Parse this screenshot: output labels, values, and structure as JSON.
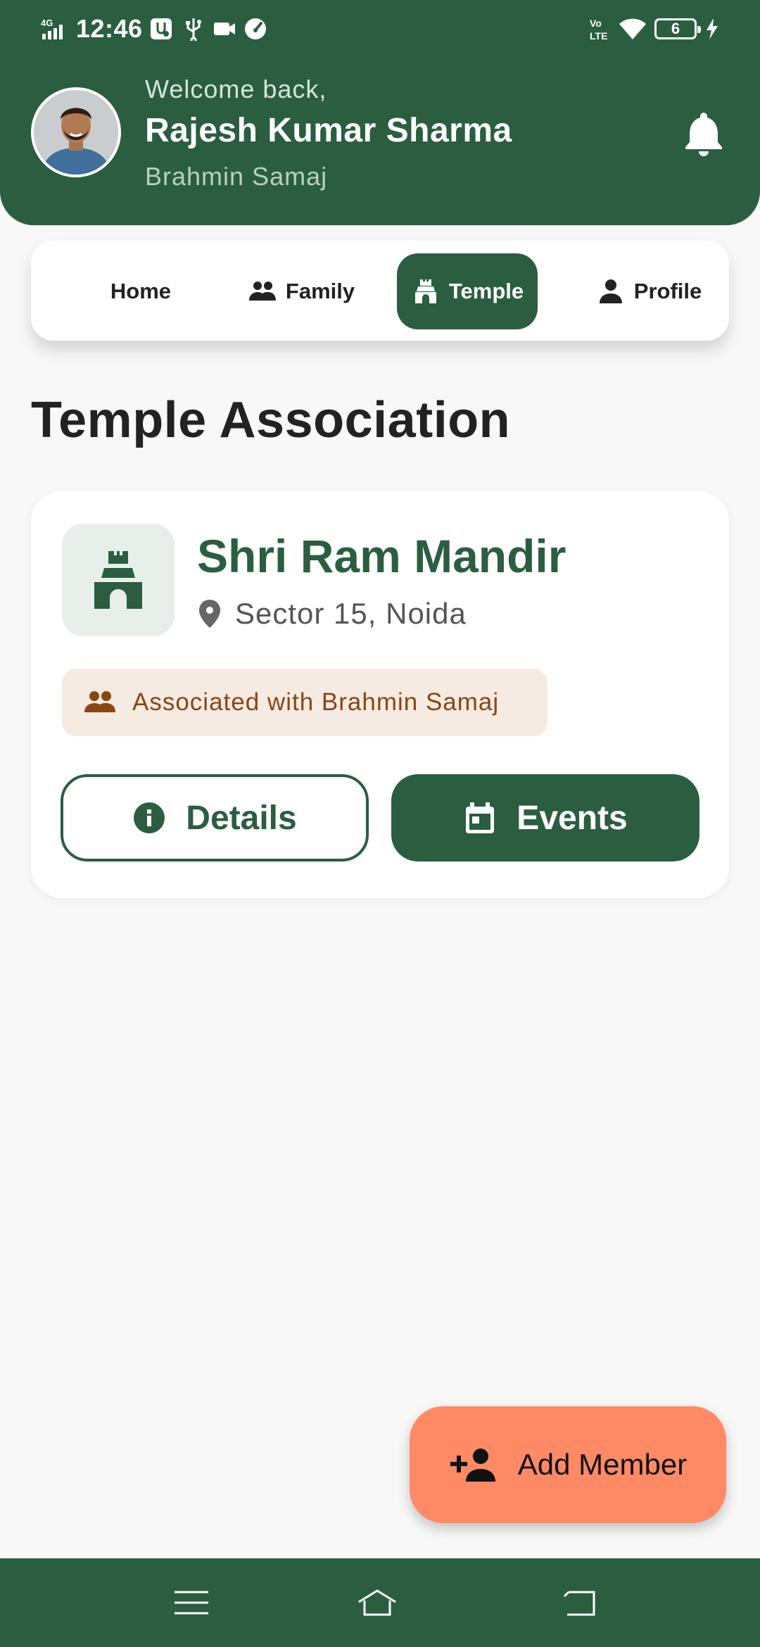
{
  "status_bar": {
    "network": "4G",
    "time": "12:46",
    "battery": "6"
  },
  "header": {
    "welcome": "Welcome back,",
    "user_name": "Rajesh Kumar Sharma",
    "samaj": "Brahmin Samaj"
  },
  "tabs": [
    {
      "label": "Home",
      "icon": "home",
      "active": false
    },
    {
      "label": "Family",
      "icon": "people-icon",
      "active": false
    },
    {
      "label": "Temple",
      "icon": "temple-icon",
      "active": true
    },
    {
      "label": "Profile",
      "icon": "person-icon",
      "active": false
    }
  ],
  "section_title": "Temple Association",
  "temple_card": {
    "name": "Shri Ram Mandir",
    "location": "Sector 15, Noida",
    "association": "Associated with Brahmin Samaj",
    "details_label": "Details",
    "events_label": "Events"
  },
  "fab": {
    "label": "Add Member",
    "icon": "person-add-icon"
  },
  "colors": {
    "primary": "#2b5e40",
    "accent": "#ff8a65",
    "badge_bg": "#f6ebe3",
    "badge_text": "#8b4513"
  }
}
